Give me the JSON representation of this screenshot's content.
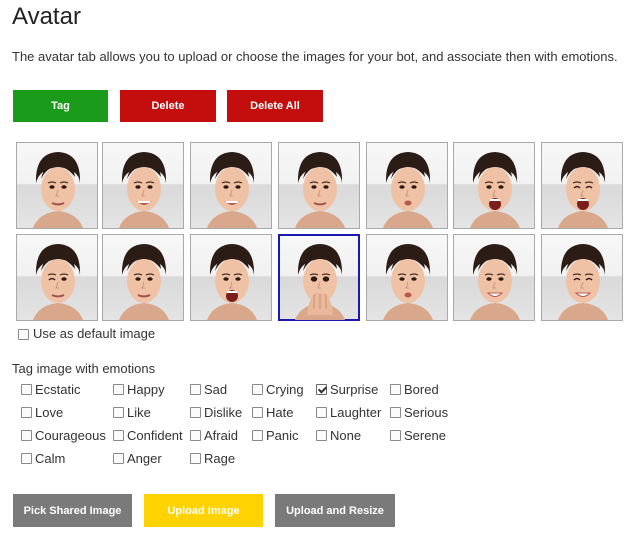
{
  "page": {
    "title": "Avatar",
    "description": "The avatar tab allows you to upload or choose the images for your bot, and associate then with emotions."
  },
  "toolbar": {
    "tag_label": "Tag",
    "delete_label": "Delete",
    "delete_all_label": "Delete All"
  },
  "colors": {
    "tag": "#1a9c1a",
    "delete": "#c40d0d",
    "gray_button": "#7a7a7a",
    "upload_button": "#ffd200",
    "selected_border": "#1a1ab0"
  },
  "images": {
    "count": 14,
    "selected_index": 10,
    "expressions": [
      "neutral",
      "smile",
      "smile-wide",
      "skeptical",
      "frown",
      "laugh-open",
      "scream-eyes-closed",
      "wink",
      "smirk",
      "surprised",
      "hand-over-mouth",
      "pout",
      "grimace",
      "grin-eyes-closed"
    ]
  },
  "default_image": {
    "label": "Use as default image",
    "checked": false
  },
  "emotions": {
    "heading": "Tag image with emotions",
    "items": [
      {
        "label": "Ecstatic",
        "checked": false
      },
      {
        "label": "Happy",
        "checked": false
      },
      {
        "label": "Sad",
        "checked": false
      },
      {
        "label": "Crying",
        "checked": false
      },
      {
        "label": "Surprise",
        "checked": true
      },
      {
        "label": "Bored",
        "checked": false
      },
      {
        "label": "Love",
        "checked": false
      },
      {
        "label": "Like",
        "checked": false
      },
      {
        "label": "Dislike",
        "checked": false
      },
      {
        "label": "Hate",
        "checked": false
      },
      {
        "label": "Laughter",
        "checked": false
      },
      {
        "label": "Serious",
        "checked": false
      },
      {
        "label": "Courageous",
        "checked": false
      },
      {
        "label": "Confident",
        "checked": false
      },
      {
        "label": "Afraid",
        "checked": false
      },
      {
        "label": "Panic",
        "checked": false
      },
      {
        "label": "None",
        "checked": false
      },
      {
        "label": "Serene",
        "checked": false
      },
      {
        "label": "Calm",
        "checked": false
      },
      {
        "label": "Anger",
        "checked": false
      },
      {
        "label": "Rage",
        "checked": false
      }
    ]
  },
  "bottom_buttons": {
    "pick_shared_label": "Pick Shared Image",
    "upload_label": "Upload Image",
    "upload_resize_label": "Upload and Resize"
  }
}
